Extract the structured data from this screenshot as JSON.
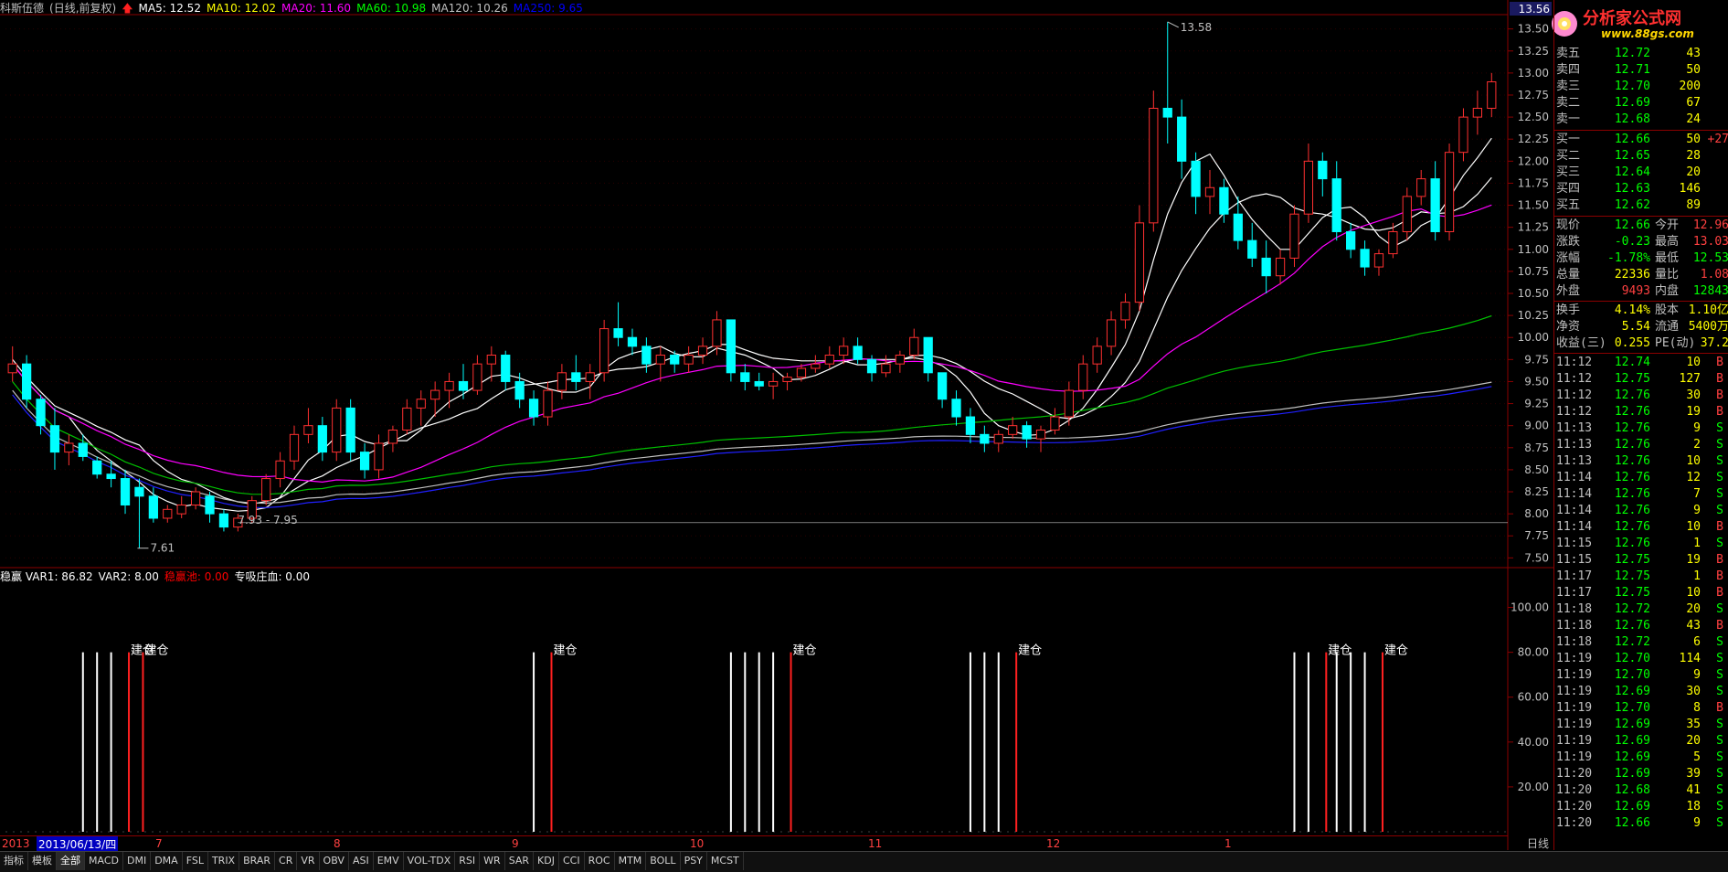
{
  "title_bar": {
    "stock": "科斯伍德",
    "mode": "(日线,前复权)",
    "ma_items": [
      {
        "label": "MA5:",
        "value": "12.52",
        "color": "#ffffff"
      },
      {
        "label": "MA10:",
        "value": "12.02",
        "color": "#ffff00"
      },
      {
        "label": "MA20:",
        "value": "11.60",
        "color": "#ff00ff"
      },
      {
        "label": "MA60:",
        "value": "10.98",
        "color": "#00ff00"
      },
      {
        "label": "MA120:",
        "value": "10.26",
        "color": "#c0c0c0"
      },
      {
        "label": "MA250:",
        "value": "9.65",
        "color": "#0000ff"
      }
    ]
  },
  "price_axis": {
    "top_label": "13.56",
    "ticks": [
      "13.50",
      "13.25",
      "13.00",
      "12.75",
      "12.50",
      "12.25",
      "12.00",
      "11.75",
      "11.50",
      "11.25",
      "11.00",
      "10.75",
      "10.50",
      "10.25",
      "10.00",
      "9.75",
      "9.50",
      "9.25",
      "9.00",
      "8.75",
      "8.50",
      "8.25",
      "8.00",
      "7.75",
      "7.50"
    ]
  },
  "annotations": {
    "high_label": "13.58",
    "low_label": "7.61",
    "range_label": "7.93 - 7.95"
  },
  "indicator": {
    "header": [
      {
        "label": "稳赢 VAR1:",
        "value": "86.82",
        "color": "#ffffff"
      },
      {
        "label": "VAR2:",
        "value": "8.00",
        "color": "#ffffff"
      },
      {
        "label": "稳赢池:",
        "value": "0.00",
        "color": "#ff0000"
      },
      {
        "label": "专吸庄血:",
        "value": "0.00",
        "color": "#ffffff"
      }
    ],
    "axis_ticks": [
      "100.00",
      "80.00",
      "60.00",
      "40.00",
      "20.00"
    ],
    "signal_text": "建仓"
  },
  "chart_data": {
    "type": "candlestick",
    "ylim": [
      7.4,
      13.6
    ],
    "indicator_ylim": [
      0,
      110
    ],
    "candles": [
      [
        9.6,
        9.9,
        9.5,
        9.7
      ],
      [
        9.7,
        9.8,
        9.2,
        9.3
      ],
      [
        9.3,
        9.35,
        8.9,
        9.0
      ],
      [
        9.0,
        9.2,
        8.5,
        8.7
      ],
      [
        8.7,
        8.9,
        8.55,
        8.8
      ],
      [
        8.8,
        8.9,
        8.6,
        8.65
      ],
      [
        8.6,
        8.65,
        8.4,
        8.45
      ],
      [
        8.45,
        8.6,
        8.3,
        8.4
      ],
      [
        8.4,
        8.5,
        8.0,
        8.1
      ],
      [
        8.3,
        8.4,
        7.61,
        8.2
      ],
      [
        8.2,
        8.3,
        7.9,
        7.95
      ],
      [
        7.95,
        8.1,
        7.9,
        8.05
      ],
      [
        8.0,
        8.2,
        7.95,
        8.1
      ],
      [
        8.1,
        8.3,
        8.05,
        8.25
      ],
      [
        8.2,
        8.25,
        7.9,
        8.0
      ],
      [
        8.0,
        8.05,
        7.8,
        7.85
      ],
      [
        7.85,
        8.0,
        7.8,
        7.95
      ],
      [
        7.95,
        8.2,
        7.9,
        8.15
      ],
      [
        8.15,
        8.45,
        8.1,
        8.4
      ],
      [
        8.4,
        8.7,
        8.3,
        8.6
      ],
      [
        8.6,
        9.0,
        8.5,
        8.9
      ],
      [
        8.9,
        9.2,
        8.8,
        9.0
      ],
      [
        9.0,
        9.1,
        8.6,
        8.7
      ],
      [
        8.7,
        9.3,
        8.6,
        9.2
      ],
      [
        9.2,
        9.3,
        8.6,
        8.7
      ],
      [
        8.7,
        8.8,
        8.4,
        8.5
      ],
      [
        8.5,
        8.9,
        8.4,
        8.8
      ],
      [
        8.8,
        9.0,
        8.7,
        8.95
      ],
      [
        8.95,
        9.3,
        8.9,
        9.2
      ],
      [
        9.2,
        9.4,
        9.0,
        9.3
      ],
      [
        9.3,
        9.5,
        9.1,
        9.4
      ],
      [
        9.4,
        9.6,
        9.2,
        9.5
      ],
      [
        9.5,
        9.7,
        9.3,
        9.4
      ],
      [
        9.4,
        9.8,
        9.35,
        9.7
      ],
      [
        9.7,
        9.9,
        9.5,
        9.8
      ],
      [
        9.8,
        9.85,
        9.4,
        9.5
      ],
      [
        9.5,
        9.6,
        9.2,
        9.3
      ],
      [
        9.3,
        9.4,
        9.0,
        9.1
      ],
      [
        9.1,
        9.5,
        9.0,
        9.4
      ],
      [
        9.4,
        9.7,
        9.3,
        9.6
      ],
      [
        9.6,
        9.8,
        9.4,
        9.5
      ],
      [
        9.5,
        9.7,
        9.3,
        9.6
      ],
      [
        9.6,
        10.2,
        9.5,
        10.1
      ],
      [
        10.1,
        10.4,
        9.9,
        10.0
      ],
      [
        10.0,
        10.1,
        9.8,
        9.9
      ],
      [
        9.9,
        10.0,
        9.6,
        9.7
      ],
      [
        9.7,
        9.9,
        9.5,
        9.8
      ],
      [
        9.8,
        9.85,
        9.6,
        9.7
      ],
      [
        9.7,
        9.9,
        9.6,
        9.8
      ],
      [
        9.8,
        10.0,
        9.7,
        9.9
      ],
      [
        9.9,
        10.3,
        9.8,
        10.2
      ],
      [
        10.2,
        10.2,
        9.5,
        9.6
      ],
      [
        9.6,
        9.7,
        9.4,
        9.5
      ],
      [
        9.5,
        9.6,
        9.4,
        9.45
      ],
      [
        9.45,
        9.6,
        9.3,
        9.5
      ],
      [
        9.5,
        9.6,
        9.4,
        9.55
      ],
      [
        9.55,
        9.7,
        9.5,
        9.65
      ],
      [
        9.65,
        9.8,
        9.6,
        9.7
      ],
      [
        9.7,
        9.9,
        9.65,
        9.8
      ],
      [
        9.8,
        10.0,
        9.7,
        9.9
      ],
      [
        9.9,
        10.0,
        9.7,
        9.75
      ],
      [
        9.75,
        9.8,
        9.5,
        9.6
      ],
      [
        9.6,
        9.8,
        9.55,
        9.7
      ],
      [
        9.7,
        9.85,
        9.6,
        9.8
      ],
      [
        9.8,
        10.1,
        9.75,
        10.0
      ],
      [
        10.0,
        10.0,
        9.5,
        9.6
      ],
      [
        9.6,
        9.6,
        9.2,
        9.3
      ],
      [
        9.3,
        9.4,
        9.0,
        9.1
      ],
      [
        9.1,
        9.2,
        8.8,
        8.9
      ],
      [
        8.9,
        9.0,
        8.7,
        8.8
      ],
      [
        8.8,
        8.95,
        8.7,
        8.9
      ],
      [
        8.9,
        9.1,
        8.85,
        9.0
      ],
      [
        9.0,
        9.05,
        8.75,
        8.85
      ],
      [
        8.85,
        9.0,
        8.7,
        8.95
      ],
      [
        8.95,
        9.2,
        8.9,
        9.1
      ],
      [
        9.1,
        9.5,
        9.0,
        9.4
      ],
      [
        9.4,
        9.8,
        9.3,
        9.7
      ],
      [
        9.7,
        10.0,
        9.6,
        9.9
      ],
      [
        9.9,
        10.3,
        9.8,
        10.2
      ],
      [
        10.2,
        10.5,
        10.1,
        10.4
      ],
      [
        10.4,
        11.5,
        10.3,
        11.3
      ],
      [
        11.3,
        12.8,
        11.2,
        12.6
      ],
      [
        12.6,
        13.58,
        12.2,
        12.5
      ],
      [
        12.5,
        12.7,
        11.8,
        12.0
      ],
      [
        12.0,
        12.1,
        11.4,
        11.6
      ],
      [
        11.6,
        11.9,
        11.4,
        11.7
      ],
      [
        11.7,
        11.8,
        11.3,
        11.4
      ],
      [
        11.4,
        11.6,
        11.0,
        11.1
      ],
      [
        11.1,
        11.3,
        10.8,
        10.9
      ],
      [
        10.9,
        11.1,
        10.5,
        10.7
      ],
      [
        10.7,
        11.0,
        10.6,
        10.9
      ],
      [
        10.9,
        11.5,
        10.8,
        11.4
      ],
      [
        11.4,
        12.2,
        11.3,
        12.0
      ],
      [
        12.0,
        12.1,
        11.6,
        11.8
      ],
      [
        11.8,
        12.0,
        11.1,
        11.2
      ],
      [
        11.2,
        11.3,
        10.9,
        11.0
      ],
      [
        11.0,
        11.1,
        10.7,
        10.8
      ],
      [
        10.8,
        11.0,
        10.7,
        10.95
      ],
      [
        10.95,
        11.3,
        10.9,
        11.2
      ],
      [
        11.2,
        11.7,
        11.1,
        11.6
      ],
      [
        11.6,
        11.9,
        11.5,
        11.8
      ],
      [
        11.8,
        12.0,
        11.1,
        11.2
      ],
      [
        11.2,
        12.2,
        11.1,
        12.1
      ],
      [
        12.1,
        12.6,
        12.0,
        12.5
      ],
      [
        12.5,
        12.8,
        12.3,
        12.6
      ],
      [
        12.6,
        13.0,
        12.5,
        12.9
      ]
    ],
    "signal_bars": [
      {
        "x": 5,
        "v": 80
      },
      {
        "x": 6,
        "v": 80
      },
      {
        "x": 7,
        "v": 80
      },
      {
        "x": 8,
        "v": 80,
        "red": true
      },
      {
        "x": 9,
        "v": 80,
        "red": true
      },
      {
        "x": 37,
        "v": 80
      },
      {
        "x": 38,
        "v": 80,
        "red": true
      },
      {
        "x": 51,
        "v": 80
      },
      {
        "x": 52,
        "v": 80
      },
      {
        "x": 53,
        "v": 80
      },
      {
        "x": 54,
        "v": 80
      },
      {
        "x": 55,
        "v": 80,
        "red": true
      },
      {
        "x": 68,
        "v": 80
      },
      {
        "x": 69,
        "v": 80
      },
      {
        "x": 70,
        "v": 80
      },
      {
        "x": 71,
        "v": 80,
        "red": true
      },
      {
        "x": 91,
        "v": 80
      },
      {
        "x": 92,
        "v": 80
      },
      {
        "x": 93,
        "v": 80,
        "red": true
      },
      {
        "x": 94,
        "v": 80
      },
      {
        "x": 95,
        "v": 80
      },
      {
        "x": 96,
        "v": 80
      },
      {
        "x": 97,
        "v": 80,
        "red": true
      }
    ],
    "signal_labels": [
      {
        "x": 8,
        "text": "建仓"
      },
      {
        "x": 9,
        "text": "建仓"
      },
      {
        "x": 38,
        "text": "建仓"
      },
      {
        "x": 55,
        "text": "建仓"
      },
      {
        "x": 71,
        "text": "建仓"
      },
      {
        "x": 93,
        "text": "建仓"
      },
      {
        "x": 97,
        "text": "建仓"
      }
    ]
  },
  "date_axis": {
    "first": "2013",
    "cursor_date": "2013/06/13/四",
    "months": [
      "7",
      "8",
      "9",
      "10",
      "11",
      "12",
      "1"
    ]
  },
  "right_panel": {
    "sell": [
      {
        "label": "卖五",
        "price": "12.72",
        "vol": "43"
      },
      {
        "label": "卖四",
        "price": "12.71",
        "vol": "50"
      },
      {
        "label": "卖三",
        "price": "12.70",
        "vol": "200"
      },
      {
        "label": "卖二",
        "price": "12.69",
        "vol": "67"
      },
      {
        "label": "卖一",
        "price": "12.68",
        "vol": "24"
      }
    ],
    "buy": [
      {
        "label": "买一",
        "price": "12.66",
        "vol": "50",
        "extra": "+27"
      },
      {
        "label": "买二",
        "price": "12.65",
        "vol": "28",
        "extra": ""
      },
      {
        "label": "买三",
        "price": "12.64",
        "vol": "20",
        "extra": ""
      },
      {
        "label": "买四",
        "price": "12.63",
        "vol": "146",
        "extra": ""
      },
      {
        "label": "买五",
        "price": "12.62",
        "vol": "89",
        "extra": ""
      }
    ],
    "stats": [
      {
        "l1": "现价",
        "v1": "12.66",
        "l2": "今开",
        "v2": "12.96",
        "c1": "#00ff00",
        "c2": "#ff4040"
      },
      {
        "l1": "涨跌",
        "v1": "-0.23",
        "l2": "最高",
        "v2": "13.03",
        "c1": "#00ff00",
        "c2": "#ff4040"
      },
      {
        "l1": "涨幅",
        "v1": "-1.78%",
        "l2": "最低",
        "v2": "12.53",
        "c1": "#00ff00",
        "c2": "#00ff00"
      },
      {
        "l1": "总量",
        "v1": "22336",
        "l2": "量比",
        "v2": "1.08",
        "c1": "#ffff00",
        "c2": "#ff4040"
      },
      {
        "l1": "外盘",
        "v1": "9493",
        "l2": "内盘",
        "v2": "12843",
        "c1": "#ff4040",
        "c2": "#00ff00"
      },
      {
        "l1": "换手",
        "v1": "4.14%",
        "l2": "股本",
        "v2": "1.10亿",
        "c1": "#ffff00",
        "c2": "#ffff00"
      },
      {
        "l1": "净资",
        "v1": "5.54",
        "l2": "流通",
        "v2": "5400万",
        "c1": "#ffff00",
        "c2": "#ffff00"
      },
      {
        "l1": "收益(三)",
        "v1": "0.255",
        "l2": "PE(动)",
        "v2": "37.2",
        "c1": "#ffff00",
        "c2": "#ffff00"
      }
    ],
    "ticks": [
      {
        "t": "11:12",
        "p": "12.74",
        "v": "10",
        "s": "B"
      },
      {
        "t": "11:12",
        "p": "12.75",
        "v": "127",
        "s": "B"
      },
      {
        "t": "11:12",
        "p": "12.76",
        "v": "30",
        "s": "B"
      },
      {
        "t": "11:12",
        "p": "12.76",
        "v": "19",
        "s": "B"
      },
      {
        "t": "11:13",
        "p": "12.76",
        "v": "9",
        "s": "S"
      },
      {
        "t": "11:13",
        "p": "12.76",
        "v": "2",
        "s": "S"
      },
      {
        "t": "11:13",
        "p": "12.76",
        "v": "10",
        "s": "S"
      },
      {
        "t": "11:14",
        "p": "12.76",
        "v": "12",
        "s": "S"
      },
      {
        "t": "11:14",
        "p": "12.76",
        "v": "7",
        "s": "S"
      },
      {
        "t": "11:14",
        "p": "12.76",
        "v": "9",
        "s": "S"
      },
      {
        "t": "11:14",
        "p": "12.76",
        "v": "10",
        "s": "B"
      },
      {
        "t": "11:15",
        "p": "12.76",
        "v": "1",
        "s": "S"
      },
      {
        "t": "11:15",
        "p": "12.75",
        "v": "19",
        "s": "B"
      },
      {
        "t": "11:17",
        "p": "12.75",
        "v": "1",
        "s": "B"
      },
      {
        "t": "11:17",
        "p": "12.75",
        "v": "10",
        "s": "B"
      },
      {
        "t": "11:18",
        "p": "12.72",
        "v": "20",
        "s": "S"
      },
      {
        "t": "11:18",
        "p": "12.76",
        "v": "43",
        "s": "B"
      },
      {
        "t": "11:18",
        "p": "12.72",
        "v": "6",
        "s": "S"
      },
      {
        "t": "11:19",
        "p": "12.70",
        "v": "114",
        "s": "S"
      },
      {
        "t": "11:19",
        "p": "12.70",
        "v": "9",
        "s": "S"
      },
      {
        "t": "11:19",
        "p": "12.69",
        "v": "30",
        "s": "S"
      },
      {
        "t": "11:19",
        "p": "12.70",
        "v": "8",
        "s": "B"
      },
      {
        "t": "11:19",
        "p": "12.69",
        "v": "35",
        "s": "S"
      },
      {
        "t": "11:19",
        "p": "12.69",
        "v": "20",
        "s": "S"
      },
      {
        "t": "11:19",
        "p": "12.69",
        "v": "5",
        "s": "S"
      },
      {
        "t": "11:20",
        "p": "12.69",
        "v": "39",
        "s": "S"
      },
      {
        "t": "11:20",
        "p": "12.68",
        "v": "41",
        "s": "S"
      },
      {
        "t": "11:20",
        "p": "12.69",
        "v": "18",
        "s": "S"
      },
      {
        "t": "11:20",
        "p": "12.66",
        "v": "9",
        "s": "S"
      }
    ],
    "footer_label": "日线"
  },
  "logo": {
    "text": "分析家公式网",
    "url_text": "www.88gs.com"
  },
  "bottom_tabs": [
    "指标",
    "模板",
    "全部",
    "MACD",
    "DMI",
    "DMA",
    "FSL",
    "TRIX",
    "BRAR",
    "CR",
    "VR",
    "OBV",
    "ASI",
    "EMV",
    "VOL-TDX",
    "RSI",
    "WR",
    "SAR",
    "KDJ",
    "CCI",
    "ROC",
    "MTM",
    "BOLL",
    "PSY",
    "MCST"
  ]
}
